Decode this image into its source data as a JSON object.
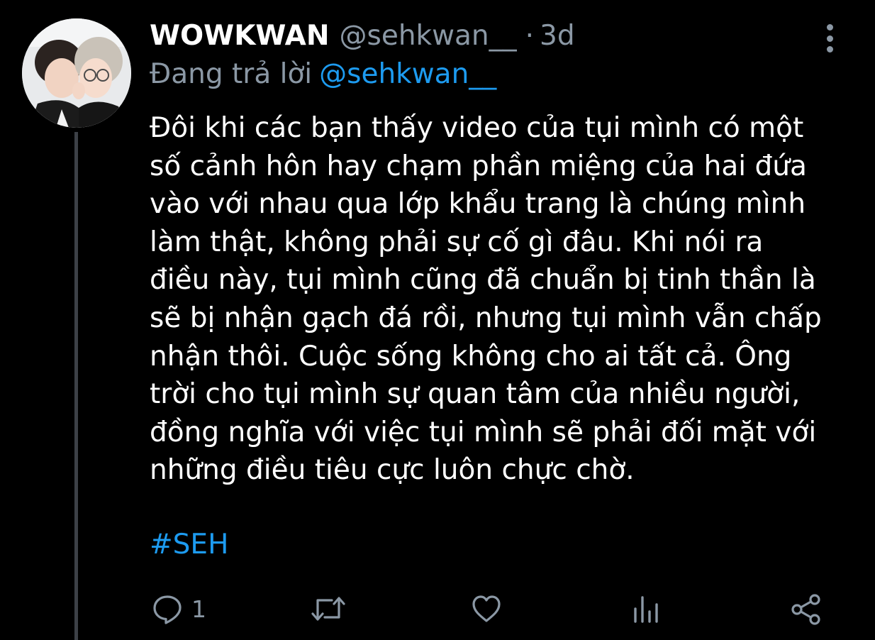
{
  "tweet": {
    "display_name": "WOWKWAN",
    "handle": "@sehkwan__",
    "separator": "·",
    "time": "3d",
    "reply_prefix": "Đang trả lời",
    "reply_handle": "@sehkwan__",
    "body_lines": [
      "Đôi khi các bạn thấy video của tụi mình có một",
      "số cảnh hôn hay chạm phần miệng của hai đứa",
      "vào với nhau qua lớp khẩu trang là chúng mình",
      "làm thật, không phải sự cố gì đâu. Khi nói ra",
      "điều này, tụi mình cũng đã chuẩn bị tinh thần là",
      "sẽ bị nhận gạch đá rồi, nhưng tụi mình vẫn chấp",
      "nhận thôi. Cuộc sống không cho ai tất cả. Ông",
      "trời cho tụi mình sự quan tâm của nhiều người,",
      "đồng nghĩa với việc tụi mình sẽ phải đối mặt với",
      "những điều tiêu cực luôn chực chờ."
    ],
    "hashtag": "#SEH"
  },
  "actions": {
    "reply_count": "1",
    "icons": [
      "reply-icon",
      "retweet-icon",
      "like-icon",
      "analytics-icon",
      "share-icon"
    ]
  },
  "colors": {
    "background": "#000000",
    "text": "#ffffff",
    "muted": "#8b98a5",
    "accent": "#1d9bf0",
    "thread_line": "#3d4147"
  }
}
